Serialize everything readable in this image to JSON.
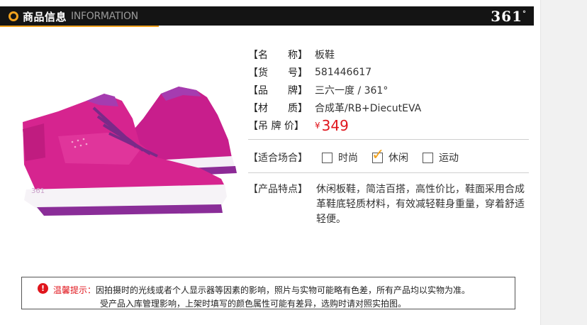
{
  "header": {
    "title_cn": "商品信息",
    "title_en": "INFORMATION",
    "brand_logo": "361",
    "brand_logo_mark": "°",
    "accent_color": "#f0a11e"
  },
  "product": {
    "name_label": "【名　　称】",
    "name_value": "板鞋",
    "sku_label": "【货　　号】",
    "sku_value": "581446617",
    "brand_label": "【品　　牌】",
    "brand_value": "三六一度 / 361°",
    "material_label": "【材　　质】",
    "material_value": "合成革/RB+DiecutEVA",
    "price_label": "【吊 牌 价】",
    "price_currency": "¥",
    "price_value": "349",
    "price_color": "#e0151c"
  },
  "occasion": {
    "label": "【适合场合】",
    "options": [
      {
        "label": "时尚",
        "checked": false
      },
      {
        "label": "休闲",
        "checked": true
      },
      {
        "label": "运动",
        "checked": false
      }
    ]
  },
  "features": {
    "label": "【产品特点】",
    "text": "休闲板鞋，简洁百搭，高性价比，鞋面采用合成革鞋底轻质材料，有效减轻鞋身重量，穿着舒适轻便。"
  },
  "notice": {
    "icon": "!",
    "prefix": "温馨提示：",
    "line1": "因拍摄时的光线或者个人显示器等因素的影响，照片与实物可能略有色差，所有产品均以实物为准。",
    "line2": "受产品入库管理影响，上架时填写的颜色属性可能有差异，选购时请对照实拍图。"
  }
}
